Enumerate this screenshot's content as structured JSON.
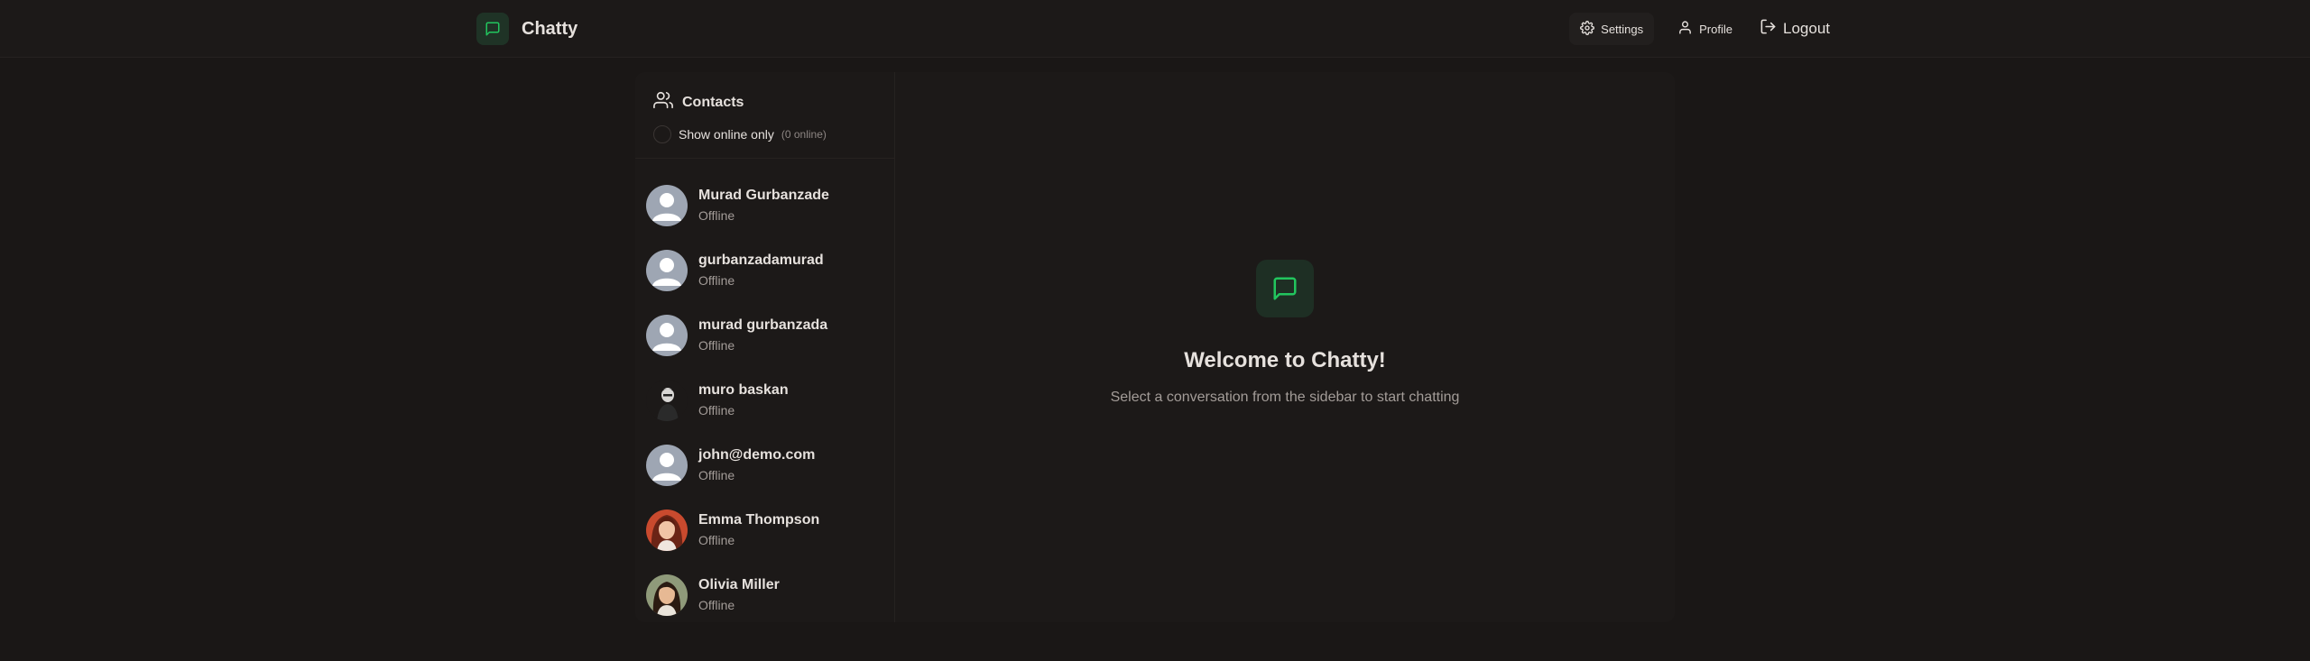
{
  "app": {
    "name": "Chatty"
  },
  "nav": {
    "settings_label": "Settings",
    "profile_label": "Profile",
    "logout_label": "Logout"
  },
  "sidebar": {
    "title": "Contacts",
    "online_filter_label": "Show online only",
    "online_count": "(0 online)",
    "contacts": [
      {
        "name": "Murad Gurbanzade",
        "status": "Offline",
        "avatar": "default-avatar"
      },
      {
        "name": "gurbanzadamurad",
        "status": "Offline",
        "avatar": "default-avatar"
      },
      {
        "name": "murad gurbanzada",
        "status": "Offline",
        "avatar": "default-avatar"
      },
      {
        "name": "muro baskan",
        "status": "Offline",
        "avatar": "photo-avatar"
      },
      {
        "name": "john@demo.com",
        "status": "Offline",
        "avatar": "default-avatar"
      },
      {
        "name": "Emma Thompson",
        "status": "Offline",
        "avatar": "photo-avatar"
      },
      {
        "name": "Olivia Miller",
        "status": "Offline",
        "avatar": "photo-avatar"
      }
    ]
  },
  "welcome": {
    "title": "Welcome to Chatty!",
    "subtitle": "Select a conversation from the sidebar to start chatting"
  },
  "colors": {
    "background": "#1a1716",
    "panel": "#1c1918",
    "accent": "#22c55e",
    "accent_bg": "#1e2f24"
  }
}
